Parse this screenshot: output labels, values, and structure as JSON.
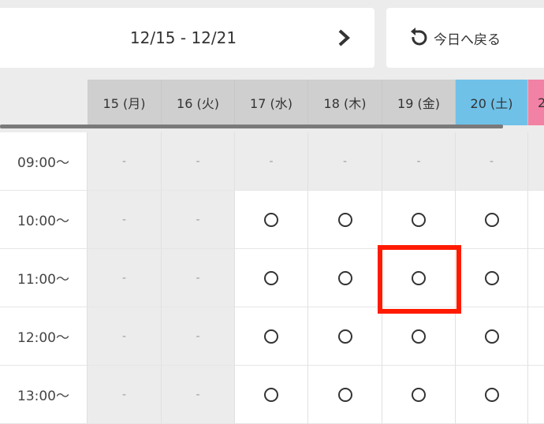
{
  "week_nav": {
    "range_label": "12/15 - 12/21",
    "next_icon": "chevron-right-icon"
  },
  "today_button": {
    "label": "今日へ戻る",
    "icon": "undo-arrow-icon"
  },
  "days": [
    {
      "label": "15 (月)",
      "type": "weekday"
    },
    {
      "label": "16 (火)",
      "type": "weekday"
    },
    {
      "label": "17 (水)",
      "type": "weekday"
    },
    {
      "label": "18 (木)",
      "type": "weekday"
    },
    {
      "label": "19 (金)",
      "type": "weekday"
    },
    {
      "label": "20 (土)",
      "type": "saturday"
    },
    {
      "label": "2",
      "type": "sunday"
    }
  ],
  "time_slots": [
    {
      "time": "09:00〜",
      "cells": [
        "-",
        "-",
        "-",
        "-",
        "-",
        "-"
      ]
    },
    {
      "time": "10:00〜",
      "cells": [
        "-",
        "-",
        "○",
        "○",
        "○",
        "○"
      ]
    },
    {
      "time": "11:00〜",
      "cells": [
        "-",
        "-",
        "○",
        "○",
        "○",
        "○"
      ]
    },
    {
      "time": "12:00〜",
      "cells": [
        "-",
        "-",
        "○",
        "○",
        "○",
        "○"
      ]
    },
    {
      "time": "13:00〜",
      "cells": [
        "-",
        "-",
        "○",
        "○",
        "○",
        "○"
      ]
    }
  ],
  "highlighted_cell": {
    "time": "11:00〜",
    "day": "19 (金)"
  },
  "colors": {
    "saturday": "#6fc1e8",
    "sunday": "#f282a5",
    "weekday_header": "#cfcfcf",
    "highlight": "#ff1a00"
  }
}
